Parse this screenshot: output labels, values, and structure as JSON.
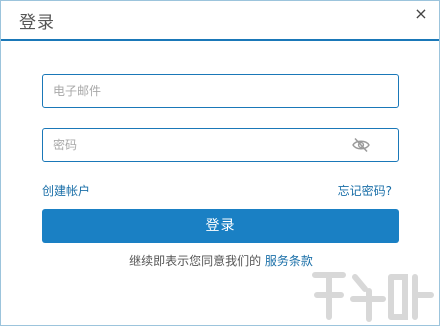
{
  "dialog": {
    "title": "登录",
    "close_icon": "close-icon",
    "close_glyph": "×"
  },
  "form": {
    "email_placeholder": "电子邮件",
    "email_value": "",
    "password_placeholder": "密码",
    "password_value": "",
    "eye_icon": "eye-hidden-icon"
  },
  "links": {
    "create_account": "创建帐户",
    "forgot_password": "忘记密码?"
  },
  "login_button": "登录",
  "terms": {
    "prefix": "继续即表示您同意我们的",
    "link": "服务条款"
  },
  "colors": {
    "accent": "#1a80c4",
    "border": "#1a78b8",
    "link": "#1a6fa8"
  }
}
